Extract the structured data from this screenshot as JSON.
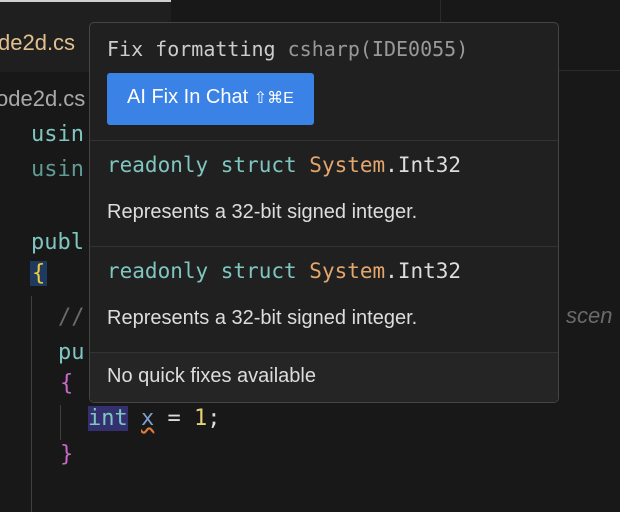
{
  "tab": {
    "label": "de2d.cs"
  },
  "breadcrumb": "ode2d.cs",
  "code": {
    "line1": "usin",
    "line2": "usin",
    "line3": "publ",
    "brace_open": "{",
    "comment": "//",
    "comment_tail": "scen",
    "line_pu": "pu",
    "inner_open": "{",
    "kw_int": "int",
    "var_x": "x",
    "rest": " = ",
    "num": "1",
    "semi": ";",
    "inner_close": "}"
  },
  "popup": {
    "title": "Fix formatting",
    "title_source": "csharp(IDE0055)",
    "ai_button": "AI Fix In Chat",
    "ai_shortcut": "⇧⌘E",
    "items": [
      {
        "kw": "readonly struct ",
        "type": "System",
        "dot": ".",
        "name": "Int32",
        "desc": "Represents a 32-bit signed integer."
      },
      {
        "kw": "readonly struct ",
        "type": "System",
        "dot": ".",
        "name": "Int32",
        "desc": "Represents a 32-bit signed integer."
      }
    ],
    "footer": "No quick fixes available"
  }
}
